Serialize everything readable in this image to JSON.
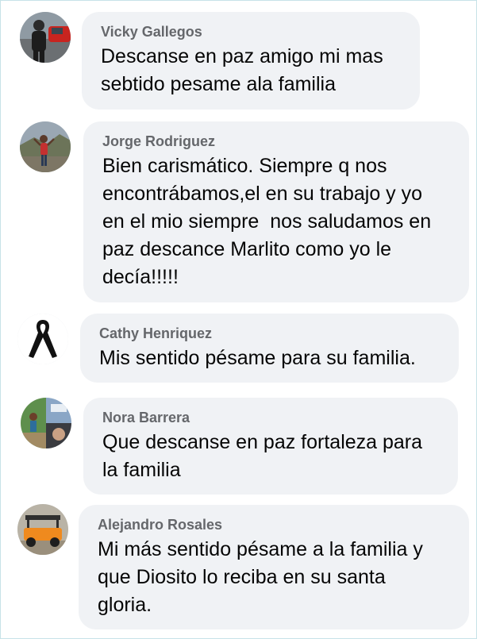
{
  "comments": [
    {
      "author": "Vicky Gallegos",
      "text": "Descanse en paz amigo mi mas\nsebtido pesame ala familia",
      "avatar_icon": "person-by-red-car-avatar-icon"
    },
    {
      "author": "Jorge Rodriguez",
      "text": "Bien carismático. Siempre q nos\nencontrábamos,el en su trabajo y yo\nen el mio siempre  nos saludamos en\npaz descance Marlito como yo le\ndecía!!!!!",
      "avatar_icon": "person-outdoors-avatar-icon"
    },
    {
      "author": "Cathy Henriquez",
      "text": "Mis sentido pésame para su familia.",
      "avatar_icon": "black-mourning-ribbon-icon"
    },
    {
      "author": "Nora Barrera",
      "text": "Que descanse en paz fortaleza para\nla familia",
      "avatar_icon": "photo-collage-avatar-icon"
    },
    {
      "author": "Alejandro Rosales",
      "text": "Mi más sentido pésame a la familia y\nque Diosito lo reciba en su santa\ngloria.",
      "avatar_icon": "orange-golf-cart-avatar-icon"
    }
  ]
}
